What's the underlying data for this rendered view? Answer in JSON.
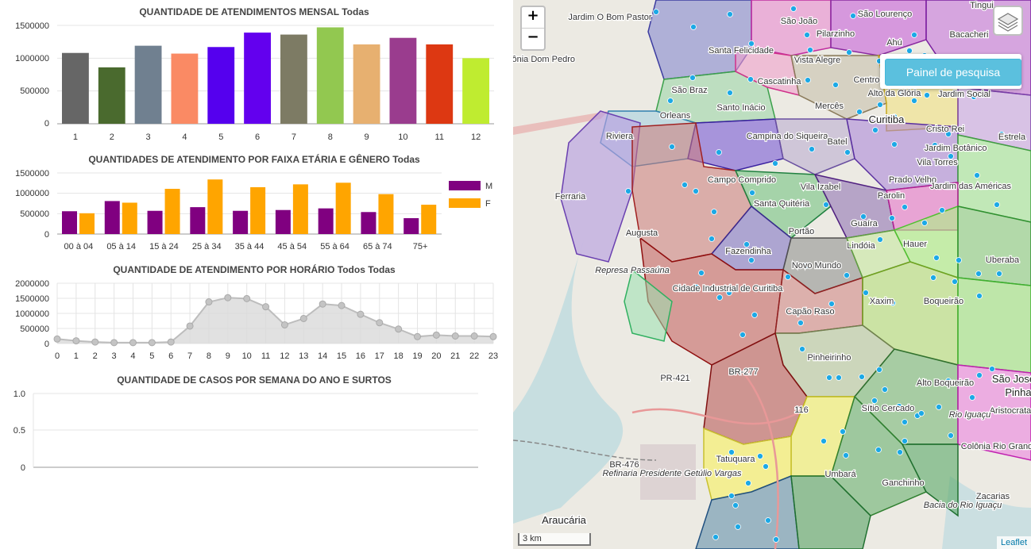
{
  "charts": {
    "monthly": {
      "title": "QUANTIDADE DE ATENDIMENTOS MENSAL  Todas",
      "y_ticks": [
        "1500000",
        "1000000",
        "500000",
        "0"
      ]
    },
    "age_gender": {
      "title": "QUANTIDADES DE ATENDIMENTO POR FAIXA ETÁRIA E GÊNERO  Todas",
      "y_ticks": [
        "1500000",
        "1000000",
        "500000",
        "0"
      ],
      "legend": [
        {
          "label": "M",
          "color": "#800080"
        },
        {
          "label": "F",
          "color": "#ffa500"
        }
      ]
    },
    "hourly": {
      "title": "QUANTIDADE DE ATENDIMENTO POR HORÁRIO Todos  Todas",
      "y_ticks": [
        "2000000",
        "1500000",
        "1000000",
        "500000",
        "0"
      ]
    },
    "weekly": {
      "title": "QUANTIDADE DE CASOS POR SEMANA DO ANO E SURTOS",
      "y_ticks": [
        "1.0",
        "0.5",
        "0"
      ]
    }
  },
  "chart_data": [
    {
      "type": "bar",
      "title": "QUANTIDADE DE ATENDIMENTOS MENSAL  Todas",
      "categories": [
        "1",
        "2",
        "3",
        "4",
        "5",
        "6",
        "7",
        "8",
        "9",
        "10",
        "11",
        "12"
      ],
      "values": [
        1080000,
        860000,
        1190000,
        1070000,
        1170000,
        1390000,
        1360000,
        1470000,
        1210000,
        1310000,
        1210000,
        1000000
      ],
      "colors": [
        "#666666",
        "#4a6a2e",
        "#708090",
        "#fa8a64",
        "#5500ee",
        "#6300ee",
        "#7d7b64",
        "#92c850",
        "#e7b070",
        "#9a3c8e",
        "#dd3812",
        "#bfec30"
      ],
      "ylim": [
        0,
        1500000
      ]
    },
    {
      "type": "bar",
      "title": "QUANTIDADES DE ATENDIMENTO POR FAIXA ETÁRIA E GÊNERO  Todas",
      "categories": [
        "00 à 04",
        "05 à 14",
        "15 à 24",
        "25 à 34",
        "35 à 44",
        "45 à 54",
        "55 à 64",
        "65 à 74",
        "75+"
      ],
      "series": [
        {
          "name": "M",
          "values": [
            560000,
            810000,
            570000,
            660000,
            570000,
            590000,
            630000,
            540000,
            390000
          ],
          "color": "#800080"
        },
        {
          "name": "F",
          "values": [
            510000,
            770000,
            1110000,
            1340000,
            1150000,
            1220000,
            1260000,
            980000,
            720000
          ],
          "color": "#ffa500"
        }
      ],
      "ylim": [
        0,
        1500000
      ],
      "legend": "right"
    },
    {
      "type": "area",
      "title": "QUANTIDADE DE ATENDIMENTO POR HORÁRIO Todos  Todas",
      "x": [
        "0",
        "1",
        "2",
        "3",
        "4",
        "5",
        "6",
        "7",
        "8",
        "9",
        "10",
        "11",
        "12",
        "13",
        "14",
        "15",
        "16",
        "17",
        "18",
        "19",
        "20",
        "21",
        "22",
        "23"
      ],
      "values": [
        150000,
        90000,
        50000,
        30000,
        30000,
        30000,
        50000,
        580000,
        1380000,
        1520000,
        1490000,
        1220000,
        620000,
        830000,
        1310000,
        1260000,
        970000,
        690000,
        480000,
        230000,
        280000,
        250000,
        250000,
        230000
      ],
      "ylim": [
        0,
        2000000
      ]
    },
    {
      "type": "line",
      "title": "QUANTIDADE DE CASOS POR SEMANA DO ANO E SURTOS",
      "values": [],
      "ylim": [
        0,
        1.0
      ]
    }
  ],
  "map": {
    "zoom_in": "+",
    "zoom_out": "−",
    "search_button": "Painel de pesquisa",
    "scale": "3 km",
    "attribution": "Leaflet",
    "labels": {
      "jardim_o_bom_pastor": "Jardim O Bom Pastor",
      "sao_joao": "São João",
      "sao_lourenco": "São Lourenço",
      "tingui": "Tingui",
      "pilarzinho": "Pilarzinho",
      "bacacheri": "Bacacheri",
      "colonia_dom_pedro": "Colônia Dom Pedro",
      "santa_felicidade": "Santa Felicidade",
      "vista_alegre": "Vista Alegre",
      "ahu": "Ahú",
      "cascatinha": "Cascatinha",
      "centro_civico": "Centro",
      "sao_braz": "São Braz",
      "alto_da_gloria": "Alto da Glória",
      "jardim_social": "Jardim Social",
      "santo_inacio": "Santo Inácio",
      "merces": "Mercês",
      "orleans": "Orleans",
      "curitiba": "Curitiba",
      "cristo_rei": "Cristo Rei",
      "estrela": "Estrela",
      "riviera": "Riviera",
      "campina_do_siqueira": "Campina do Siqueira",
      "batel": "Batel",
      "jardim_botanico": "Jardim Botânico",
      "vila_torres": "Vila Torres",
      "ferraria": "Ferraria",
      "campo_comprido": "Campo Comprido",
      "vila_izabel": "Vila Izabel",
      "prado_velho": "Prado Velho",
      "jardim_das_americas": "Jardim das Américas",
      "santa_quiteria": "Santa Quitéria",
      "parolin": "Parolin",
      "augusta": "Augusta",
      "guaira": "Guaíra",
      "portao": "Portão",
      "hauer": "Hauer",
      "uberaba": "Uberaba",
      "fazendinha": "Fazendinha",
      "lindoia": "Lindóia",
      "represa_passauna": "Represa Passaúna",
      "novo_mundo": "Novo Mundo",
      "cidade_industrial": "Cidade Industrial de Curitiba",
      "xaxim": "Xaxim",
      "boqueirao": "Boqueirão",
      "capao_raso": "Capão Raso",
      "pinheirinho": "Pinheirinho",
      "pr_421": "PR-421",
      "br_277": "BR-277",
      "sao_jose_dos_pinhais": "São José",
      "pinhais": "Pinha",
      "alto_boqueirao": "Alto Boqueirão",
      "aristocrata": "Aristocrata",
      "rio_iguacu": "Rio Iguaçu",
      "sitio_cercado": "Sítio Cercado",
      "br_476": "BR-476",
      "colonia_rio_grande": "Colônia Rio Grande",
      "refinaria": "Refinaria Presidente Getúlio Vargas",
      "tatuquara": "Tatuquara",
      "umbara": "Umbará",
      "ganchinho": "Ganchinho",
      "zacarias": "Zacarias",
      "bacia_rio_iguacu": "Bacia do Rio Iguaçu",
      "araucaria": "Araucária",
      "br_116": "116"
    }
  }
}
